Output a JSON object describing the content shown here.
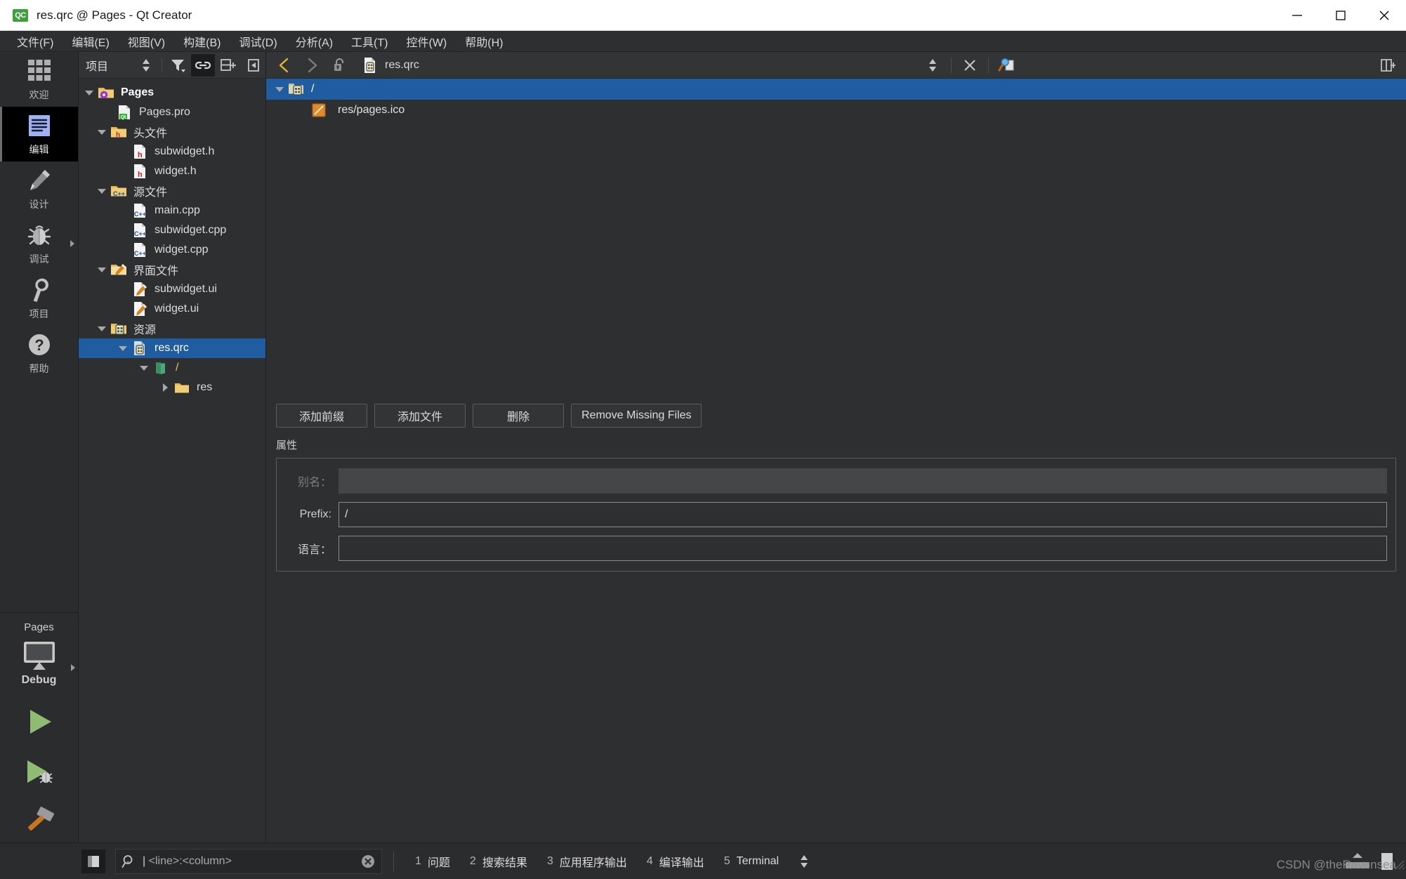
{
  "window": {
    "title": "res.qrc @ Pages - Qt Creator",
    "logo_text": "QC",
    "minimize_label": "最小化",
    "maximize_label": "最大化",
    "close_label": "关闭"
  },
  "menubar": {
    "items": [
      {
        "label": "文件(F)",
        "name": "menu-file"
      },
      {
        "label": "编辑(E)",
        "name": "menu-edit"
      },
      {
        "label": "视图(V)",
        "name": "menu-view"
      },
      {
        "label": "构建(B)",
        "name": "menu-build"
      },
      {
        "label": "调试(D)",
        "name": "menu-debug"
      },
      {
        "label": "分析(A)",
        "name": "menu-analyze"
      },
      {
        "label": "工具(T)",
        "name": "menu-tools"
      },
      {
        "label": "控件(W)",
        "name": "menu-window"
      },
      {
        "label": "帮助(H)",
        "name": "menu-help"
      }
    ]
  },
  "modebar": {
    "modes": [
      {
        "label": "欢迎",
        "icon": "grid-icon",
        "active": false,
        "has_arrow": false
      },
      {
        "label": "编辑",
        "icon": "document-lines-icon",
        "active": true,
        "has_arrow": false
      },
      {
        "label": "设计",
        "icon": "pencil-icon",
        "active": false,
        "has_arrow": false
      },
      {
        "label": "调试",
        "icon": "bug-icon",
        "active": false,
        "has_arrow": true
      },
      {
        "label": "项目",
        "icon": "wrench-icon",
        "active": false,
        "has_arrow": false
      },
      {
        "label": "帮助",
        "icon": "question-circle-icon",
        "active": false,
        "has_arrow": false
      }
    ],
    "kit": {
      "project_name": "Pages",
      "build_config": "Debug",
      "icon": "desktop-monitor-icon"
    },
    "actions": [
      {
        "name": "run-button",
        "label": "运行",
        "icon": "play-icon"
      },
      {
        "name": "debug-button",
        "label": "调试",
        "icon": "play-bug-icon"
      },
      {
        "name": "build-button",
        "label": "构建",
        "icon": "hammer-icon"
      }
    ]
  },
  "tree_panel": {
    "title": "项目",
    "toolbar": [
      {
        "name": "sync-selector",
        "icon": "updown-arrows-icon",
        "active": false
      },
      {
        "name": "filter-button",
        "icon": "filter-icon",
        "active": false
      },
      {
        "name": "link-with-editor-button",
        "icon": "link-icon",
        "active": true
      },
      {
        "name": "split-add-button",
        "icon": "split-add-icon",
        "active": false
      },
      {
        "name": "collapse-panel-button",
        "icon": "collapse-left-icon",
        "active": false
      }
    ],
    "items": [
      {
        "label": "Pages",
        "indent": 0,
        "twist": "down",
        "icon": "project-folder-icon",
        "bold": true,
        "selected": false
      },
      {
        "label": "Pages.pro",
        "indent": 1,
        "twist": "none",
        "icon": "qt-pro-file-icon",
        "bold": false,
        "selected": false
      },
      {
        "label": "头文件",
        "indent": 1,
        "twist": "down",
        "icon": "folder-h-icon",
        "bold": false,
        "selected": false
      },
      {
        "label": "subwidget.h",
        "indent": 2,
        "twist": "none",
        "icon": "h-file-icon",
        "bold": false,
        "selected": false
      },
      {
        "label": "widget.h",
        "indent": 2,
        "twist": "none",
        "icon": "h-file-icon",
        "bold": false,
        "selected": false
      },
      {
        "label": "源文件",
        "indent": 1,
        "twist": "down",
        "icon": "folder-cpp-icon",
        "bold": false,
        "selected": false
      },
      {
        "label": "main.cpp",
        "indent": 2,
        "twist": "none",
        "icon": "cpp-file-icon",
        "bold": false,
        "selected": false
      },
      {
        "label": "subwidget.cpp",
        "indent": 2,
        "twist": "none",
        "icon": "cpp-file-icon",
        "bold": false,
        "selected": false
      },
      {
        "label": "widget.cpp",
        "indent": 2,
        "twist": "none",
        "icon": "cpp-file-icon",
        "bold": false,
        "selected": false
      },
      {
        "label": "界面文件",
        "indent": 1,
        "twist": "down",
        "icon": "folder-ui-icon",
        "bold": false,
        "selected": false
      },
      {
        "label": "subwidget.ui",
        "indent": 2,
        "twist": "none",
        "icon": "ui-file-icon",
        "bold": false,
        "selected": false
      },
      {
        "label": "widget.ui",
        "indent": 2,
        "twist": "none",
        "icon": "ui-file-icon",
        "bold": false,
        "selected": false
      },
      {
        "label": "资源",
        "indent": 1,
        "twist": "down",
        "icon": "folder-qrc-icon",
        "bold": false,
        "selected": false
      },
      {
        "label": "res.qrc",
        "indent": 2,
        "twist": "down",
        "icon": "qrc-file-icon",
        "bold": false,
        "selected": true
      },
      {
        "label": "/",
        "indent": 3,
        "twist": "down",
        "icon": "prefix-icon",
        "bold": false,
        "selected": false
      },
      {
        "label": "res",
        "indent": 4,
        "twist": "right",
        "icon": "plain-folder-icon",
        "bold": false,
        "selected": false
      }
    ]
  },
  "editor": {
    "toolbar": {
      "back_label": "后退",
      "forward_label": "前进",
      "lock_label": "锁定",
      "filename": "res.qrc",
      "close_label": "关闭文档",
      "split_label": "分割"
    },
    "resource_tree": [
      {
        "label": "/",
        "indent": 0,
        "twist": "down",
        "icon": "prefix-folder-icon",
        "selected": true
      },
      {
        "label": "res/pages.ico",
        "indent": 1,
        "twist": "none",
        "icon": "image-file-icon",
        "selected": false
      }
    ],
    "buttons": [
      {
        "label": "添加前缀",
        "name": "add-prefix-button"
      },
      {
        "label": "添加文件",
        "name": "add-files-button"
      },
      {
        "label": "删除",
        "name": "remove-button"
      },
      {
        "label": "Remove Missing Files",
        "name": "remove-missing-files-button"
      }
    ],
    "properties": {
      "section_label": "属性",
      "alias_label": "别名：",
      "alias_value": "",
      "prefix_label": "Prefix:",
      "prefix_value": "/",
      "language_label": "语言：",
      "language_value": ""
    }
  },
  "statusbar": {
    "sidebar_toggle_label": "显示侧边栏",
    "locator": {
      "placeholder": "<line>:<column>",
      "icon": "magnifier-icon",
      "clear_label": "清除"
    },
    "panes": [
      {
        "num": "1",
        "name": "问题"
      },
      {
        "num": "2",
        "name": "搜索结果"
      },
      {
        "num": "3",
        "name": "应用程序输出"
      },
      {
        "num": "4",
        "name": "编译输出"
      },
      {
        "num": "5",
        "name": "Terminal"
      }
    ],
    "watermark": "CSDN @theRavensea"
  },
  "colors": {
    "selection_blue": "#1f5da0",
    "accent_green": "#8fbc72",
    "panel_bg": "#2e2f30",
    "toolbar_bg": "#333435",
    "title_bg": "#ffffff"
  }
}
